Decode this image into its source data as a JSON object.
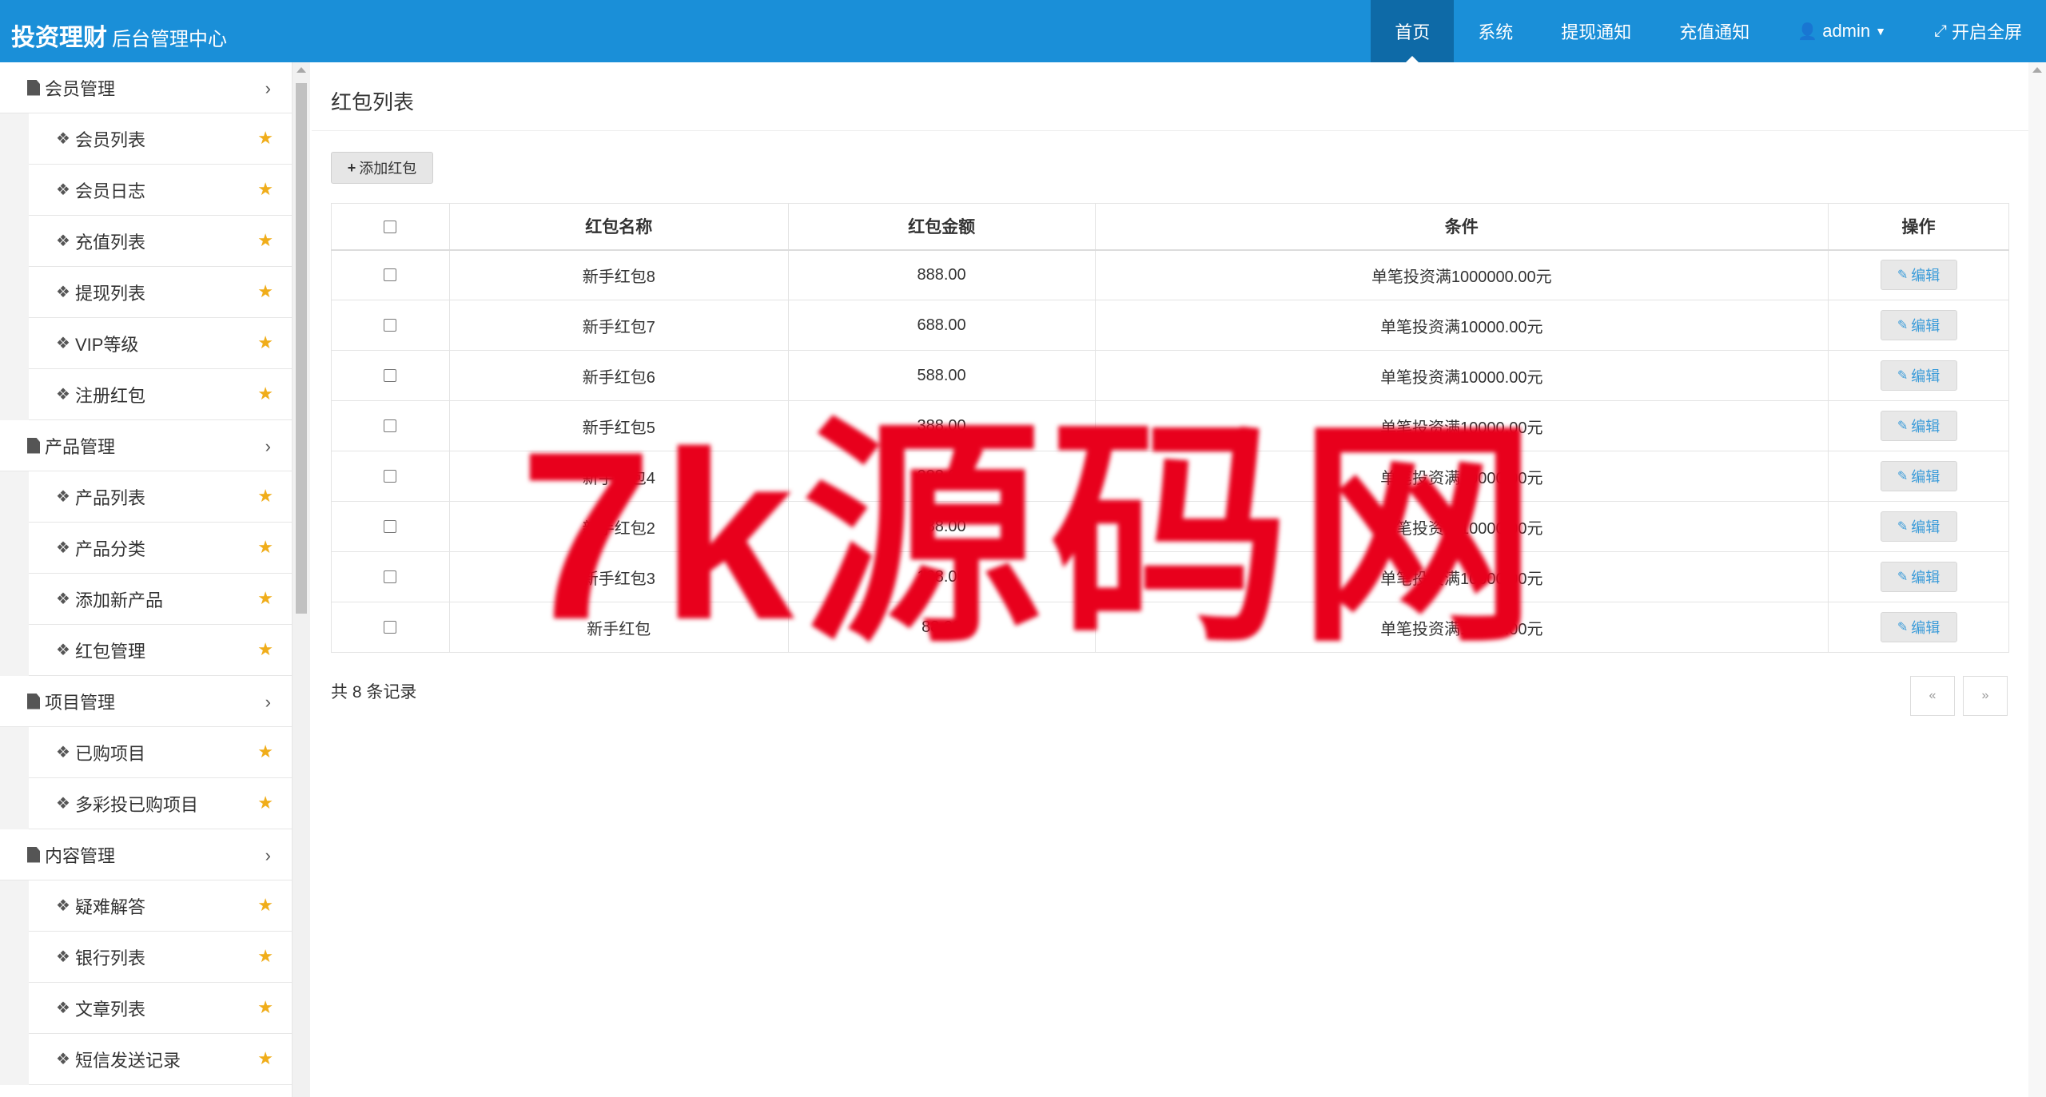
{
  "header": {
    "brand": "投资理财",
    "subtitle": "后台管理中心",
    "nav": [
      {
        "label": "首页",
        "active": true
      },
      {
        "label": "系统"
      },
      {
        "label": "提现通知"
      },
      {
        "label": "充值通知"
      },
      {
        "label": "admin"
      },
      {
        "label": "开启全屏"
      }
    ]
  },
  "sidebar": {
    "groups": [
      {
        "label": "会员管理",
        "items": [
          "会员列表",
          "会员日志",
          "充值列表",
          "提现列表",
          "VIP等级",
          "注册红包"
        ]
      },
      {
        "label": "产品管理",
        "items": [
          "产品列表",
          "产品分类",
          "添加新产品",
          "红包管理"
        ]
      },
      {
        "label": "项目管理",
        "items": [
          "已购项目",
          "多彩投已购项目"
        ]
      },
      {
        "label": "内容管理",
        "items": [
          "疑难解答",
          "银行列表",
          "文章列表",
          "短信发送记录"
        ]
      }
    ]
  },
  "main": {
    "title": "红包列表",
    "add_button": "添加红包",
    "columns": [
      "红包名称",
      "红包金额",
      "条件",
      "操作"
    ],
    "rows": [
      {
        "name": "新手红包8",
        "amount": "888.00",
        "condition": "单笔投资满1000000.00元",
        "action": "编辑"
      },
      {
        "name": "新手红包7",
        "amount": "688.00",
        "condition": "单笔投资满10000.00元",
        "action": "编辑"
      },
      {
        "name": "新手红包6",
        "amount": "588.00",
        "condition": "单笔投资满10000.00元",
        "action": "编辑"
      },
      {
        "name": "新手红包5",
        "amount": "388.00",
        "condition": "单笔投资满10000.00元",
        "action": "编辑"
      },
      {
        "name": "新手红包4",
        "amount": "288.00",
        "condition": "单笔投资满10000.00元",
        "action": "编辑"
      },
      {
        "name": "新手红包2",
        "amount": "188.00",
        "condition": "单笔投资满10000.00元",
        "action": "编辑"
      },
      {
        "name": "新手红包3",
        "amount": "168.00",
        "condition": "单笔投资满10000.00元",
        "action": "编辑"
      },
      {
        "name": "新手红包",
        "amount": "88.00",
        "condition": "单笔投资满10000.00元",
        "action": "编辑"
      }
    ],
    "total": "共 8 条记录",
    "pager": {
      "prev": "«",
      "next": "»"
    }
  },
  "watermark": "7k源码网",
  "colors": {
    "topbar": "#1a8fd8",
    "active_nav": "#0e6aa7",
    "star": "#f0ad1a",
    "edit_text": "#3a9bd9",
    "watermark": "#e8001c"
  }
}
